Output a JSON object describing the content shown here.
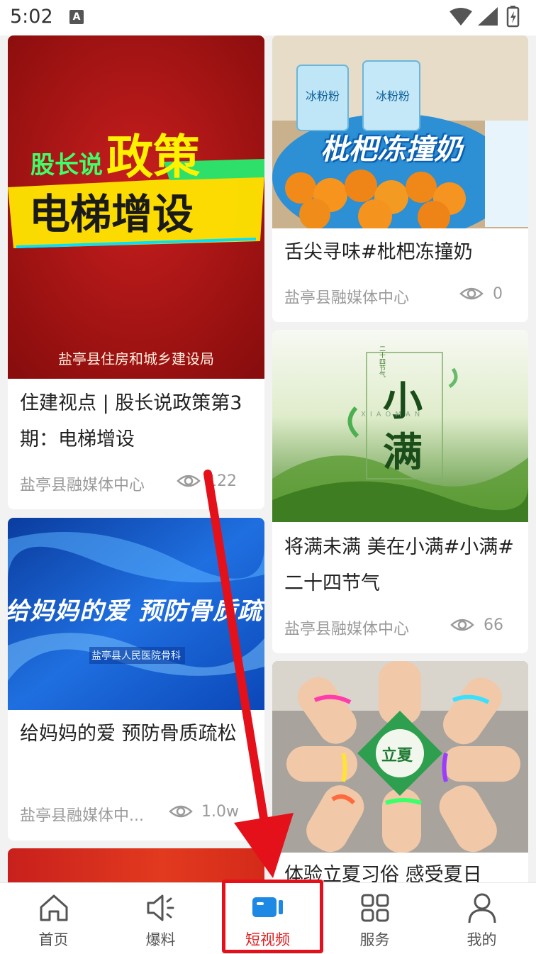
{
  "status_bar": {
    "time": "5:02",
    "notification_letter": "A"
  },
  "feed": {
    "left_column": [
      {
        "thumb_text": {
          "line1_small": "股长说",
          "line1_big": "政策",
          "line2": "电梯增设",
          "footer": "盐亭县住房和城乡建设局"
        },
        "title": "住建视点 | 股长说政策第3期：电梯增设",
        "source": "盐亭县融媒体中心",
        "views": "122"
      },
      {
        "thumb_text": {
          "headline": "给妈妈的爱 预防骨质疏",
          "sub": "盐亭县人民医院骨科"
        },
        "title": "给妈妈的爱 预防骨质疏松",
        "source": "盐亭县融媒体中...",
        "views": "1.0w"
      }
    ],
    "right_column": [
      {
        "thumb_text": {
          "headline": "枇杷冻撞奶",
          "pack_label": "冰粉粉"
        },
        "title": "舌尖寻味#枇杷冻撞奶",
        "source": "盐亭县融媒体中心",
        "views": "0"
      },
      {
        "thumb_text": {
          "char1": "小",
          "char2": "满",
          "pinyin": "XIAOMAN",
          "tag": "二十四节气"
        },
        "title": "将满未满 美在小满#小满#二十四节气",
        "source": "盐亭县融媒体中心",
        "views": "66"
      },
      {
        "thumb_text": {
          "badge": "立夏"
        },
        "title": "体验立夏习俗 感受夏日",
        "source": "",
        "views": ""
      }
    ]
  },
  "bottom_nav": [
    {
      "label": "首页",
      "icon": "home-icon",
      "active": false
    },
    {
      "label": "爆料",
      "icon": "megaphone-icon",
      "active": false
    },
    {
      "label": "短视频",
      "icon": "video-icon",
      "active": true
    },
    {
      "label": "服务",
      "icon": "grid-icon",
      "active": false
    },
    {
      "label": "我的",
      "icon": "user-icon",
      "active": false
    }
  ],
  "colors": {
    "accent": "#e02020",
    "active_icon": "#1e88e5",
    "annotation": "#e4101a"
  }
}
